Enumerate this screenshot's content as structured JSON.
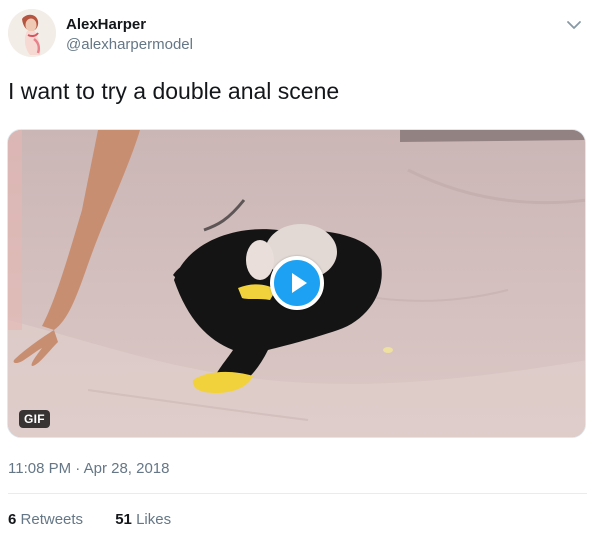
{
  "author": {
    "display_name": "AlexHarper",
    "handle": "@alexharpermodel",
    "avatar_icon": "avatar-photo"
  },
  "tweet": {
    "text": "I want to try a double anal scene",
    "timestamp": "11:08 PM · Apr 28, 2018"
  },
  "media": {
    "badge": "GIF",
    "play_icon": "play-icon",
    "accent_color": "#1da1f2"
  },
  "stats": {
    "retweets_count": "6",
    "retweets_label": "Retweets",
    "likes_count": "51",
    "likes_label": "Likes"
  },
  "menu": {
    "caret_icon": "chevron-down-icon"
  }
}
